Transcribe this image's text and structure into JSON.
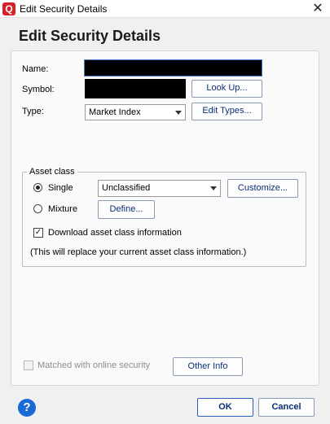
{
  "window": {
    "title": "Edit Security Details",
    "app_icon_letter": "Q",
    "close_glyph": "✕"
  },
  "heading": "Edit Security Details",
  "form": {
    "name_label": "Name:",
    "symbol_label": "Symbol:",
    "type_label": "Type:",
    "type_value": "Market Index",
    "lookup_button": "Look Up...",
    "edit_types_button": "Edit Types..."
  },
  "asset_class": {
    "legend": "Asset class",
    "single_label": "Single",
    "single_selected": true,
    "single_value": "Unclassified",
    "customize_button": "Customize...",
    "mixture_label": "Mixture",
    "define_button": "Define...",
    "download_label": "Download asset class information",
    "download_checked": true,
    "note": "(This will replace your current asset class information.)"
  },
  "footer": {
    "matched_label": "Matched with online security",
    "matched_checked": false,
    "other_info_button": "Other Info",
    "help_glyph": "?",
    "ok_button": "OK",
    "cancel_button": "Cancel"
  },
  "colors": {
    "accent": "#1a6ad6",
    "app_icon": "#d6202a",
    "button_text": "#0b2f78"
  }
}
